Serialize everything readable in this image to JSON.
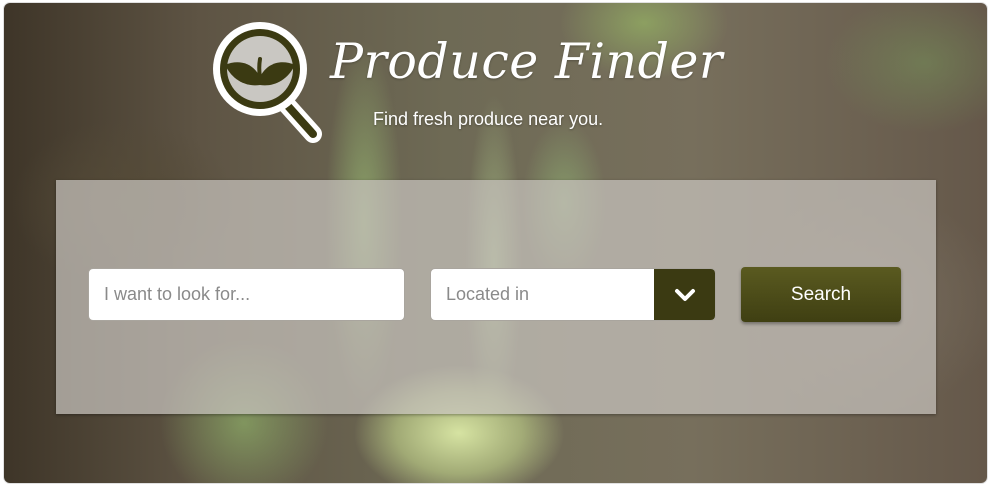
{
  "header": {
    "title": "Produce Finder",
    "tagline": "Find fresh produce near you."
  },
  "search": {
    "query_placeholder": "I want to look for...",
    "location_placeholder": "Located in",
    "button_label": "Search"
  },
  "icons": {
    "logo": "magnifier-leaf-icon",
    "dropdown": "chevron-down-icon"
  },
  "colors": {
    "brand_olive": "#3b3a12",
    "button_top": "#5a5a20",
    "button_bottom": "#3f3f12"
  }
}
